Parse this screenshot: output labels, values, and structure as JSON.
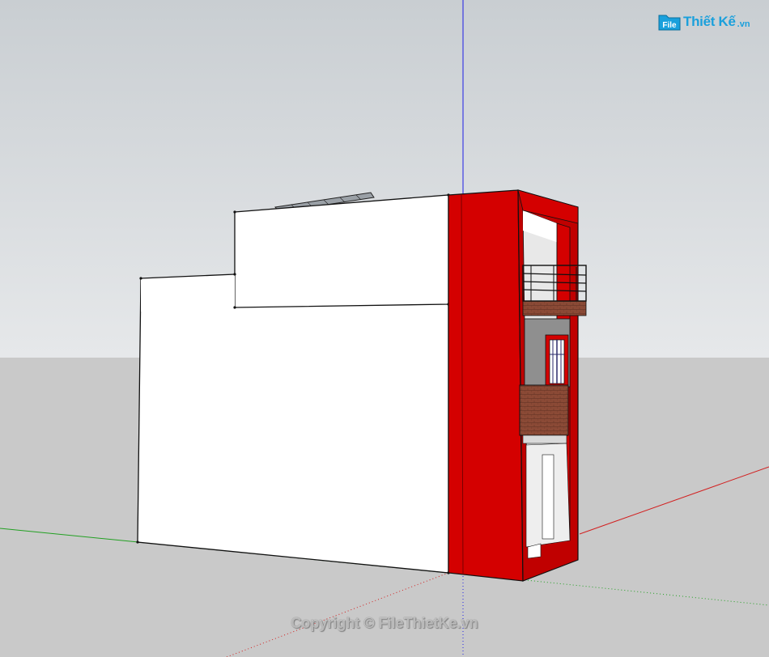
{
  "logo": {
    "icon": "file-folder-icon",
    "brand": "File",
    "name": "Thiết Kế",
    "tld": ".vn",
    "color": "#1aa0dc"
  },
  "watermark": {
    "text": "Copyright © FileThietKe.vn"
  },
  "scene": {
    "sky_color": "#d8dbde",
    "ground_color": "#c9c9c9",
    "accent_red": "#d40000",
    "wall_color": "#ffffff",
    "brick_color": "#8b4a36",
    "axis_colors": {
      "blue": "#1e1ee6",
      "red": "#d22020",
      "green": "#22a022"
    }
  }
}
